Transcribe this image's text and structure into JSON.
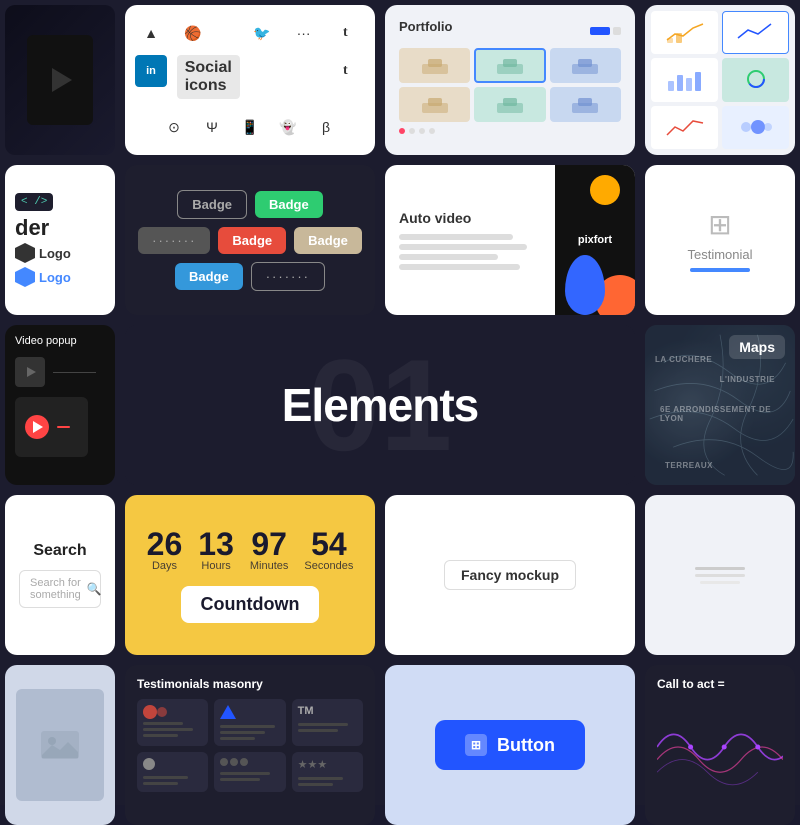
{
  "social": {
    "label": "Social icons"
  },
  "portfolio": {
    "title": "Portfolio"
  },
  "badges": {
    "items": [
      "Badge",
      "Badge",
      ".......",
      "Badge",
      "Badge",
      "Badge",
      "......."
    ]
  },
  "auto_video": {
    "title": "Auto video"
  },
  "testimonial": {
    "label": "Testimonial"
  },
  "video_popup": {
    "label": "Video popup"
  },
  "elements": {
    "title": "Elements",
    "bg_number": "01"
  },
  "maps": {
    "label": "Maps"
  },
  "search": {
    "title": "Search",
    "placeholder": "Search for something"
  },
  "countdown": {
    "days": "26",
    "hours": "13",
    "minutes": "97",
    "secondes": "54",
    "days_label": "Days",
    "hours_label": "Hours",
    "minutes_label": "Minutes",
    "secondes_label": "Secondes",
    "title": "Countdown"
  },
  "fancy_mockup": {
    "label": "Fancy mockup"
  },
  "testimonials_masonry": {
    "title": "Testimonials masonry"
  },
  "button": {
    "label": "Button"
  },
  "call_to_act": {
    "label": "Call to act ="
  }
}
